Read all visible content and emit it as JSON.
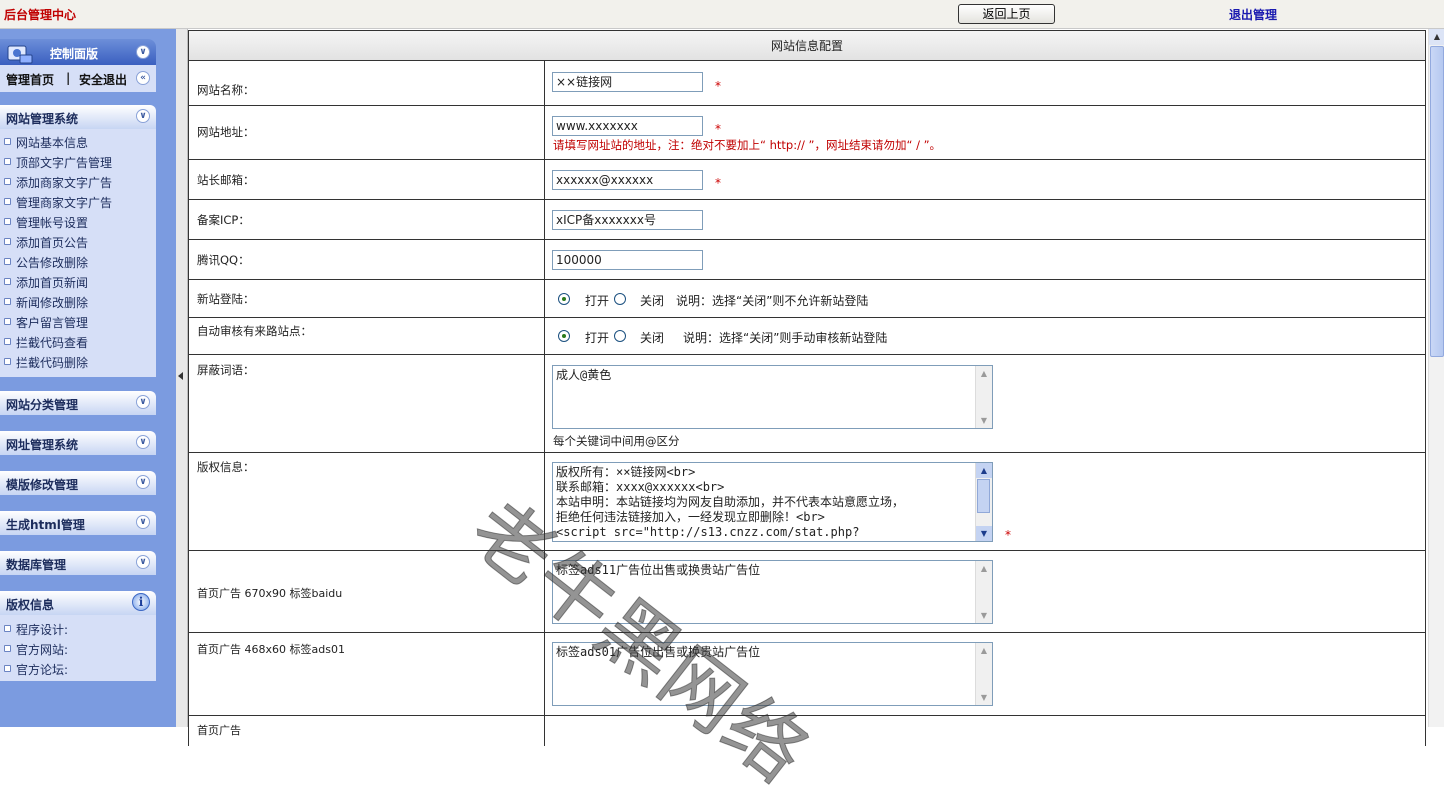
{
  "header": {
    "app_title": "后台管理中心",
    "back_button": "返回上页",
    "logout_link": "退出管理"
  },
  "sidebar": {
    "control_panel": {
      "title": "控制面版",
      "home_link": "管理首页",
      "separator": "|",
      "safe_exit_link": "安全退出"
    },
    "site_system": {
      "title": "网站管理系统",
      "items": [
        "网站基本信息",
        "顶部文字广告管理",
        "添加商家文字广告",
        "管理商家文字广告",
        "管理帐号设置",
        "添加首页公告",
        "公告修改删除",
        "添加首页新闻",
        "新闻修改删除",
        "客户留言管理",
        "拦截代码查看",
        "拦截代码删除"
      ]
    },
    "collapsed_sections": [
      "网站分类管理",
      "网址管理系统",
      "模版修改管理",
      "生成html管理",
      "数据库管理"
    ],
    "copyright": {
      "title": "版权信息",
      "items": [
        "程序设计:",
        "官方网站:",
        "官方论坛:"
      ]
    }
  },
  "form": {
    "title": "网站信息配置",
    "site_name": {
      "label": "网站名称：",
      "value": "××链接网",
      "required": "*"
    },
    "site_url": {
      "label": "网站地址：",
      "value": "www.xxxxxxx",
      "required": "*",
      "note": "请填写网址站的地址，注：绝对不要加上“ http:// ”，网址结束请勿加“ / ”。"
    },
    "admin_email": {
      "label": "站长邮箱：",
      "value": "xxxxxx@xxxxxx",
      "required": "*"
    },
    "icp": {
      "label": "备案ICP：",
      "value": "xICP备xxxxxxx号"
    },
    "qq": {
      "label": "腾讯QQ：",
      "value": "100000"
    },
    "new_site_login": {
      "label": "新站登陆：",
      "on": "打开",
      "off": "关闭",
      "note": "说明：选择“关闭”则不允许新站登陆",
      "selected": "打开"
    },
    "auto_review": {
      "label": "自动审核有来路站点：",
      "on": "打开",
      "off": "关闭",
      "note": "说明：选择“关闭”则手动审核新站登陆",
      "selected": "打开"
    },
    "blocked_words": {
      "label": "屏蔽词语：",
      "value": "成人@黄色",
      "hint": "每个关键词中间用@区分"
    },
    "copyright_info": {
      "label": "版权信息：",
      "required": "*",
      "value": "版权所有：××链接网<br>\n联系邮箱：xxxx@xxxxxx<br>\n本站申明：本站链接均为网友自助添加，并不代表本站意愿立场，\n拒绝任何违法链接加入，一经发现立即删除！<br>\n<script src=\"http://s13.cnzz.com/stat.php?"
    },
    "ad_home_670": {
      "label": "首页广告 670x90 标签baidu",
      "value": "标签ads11广告位出售或换贵站广告位"
    },
    "ad_home_468": {
      "label": "首页广告 468x60 标签ads01",
      "value": "标签ads01广告位出售或换贵站广告位"
    },
    "ad_partial_label": "首页广告"
  },
  "watermark": "老牛黑网络",
  "colors": {
    "sidebar_bg": "#7b9be0",
    "title_red": "#c00000",
    "link_blue": "#1a1ab0"
  }
}
